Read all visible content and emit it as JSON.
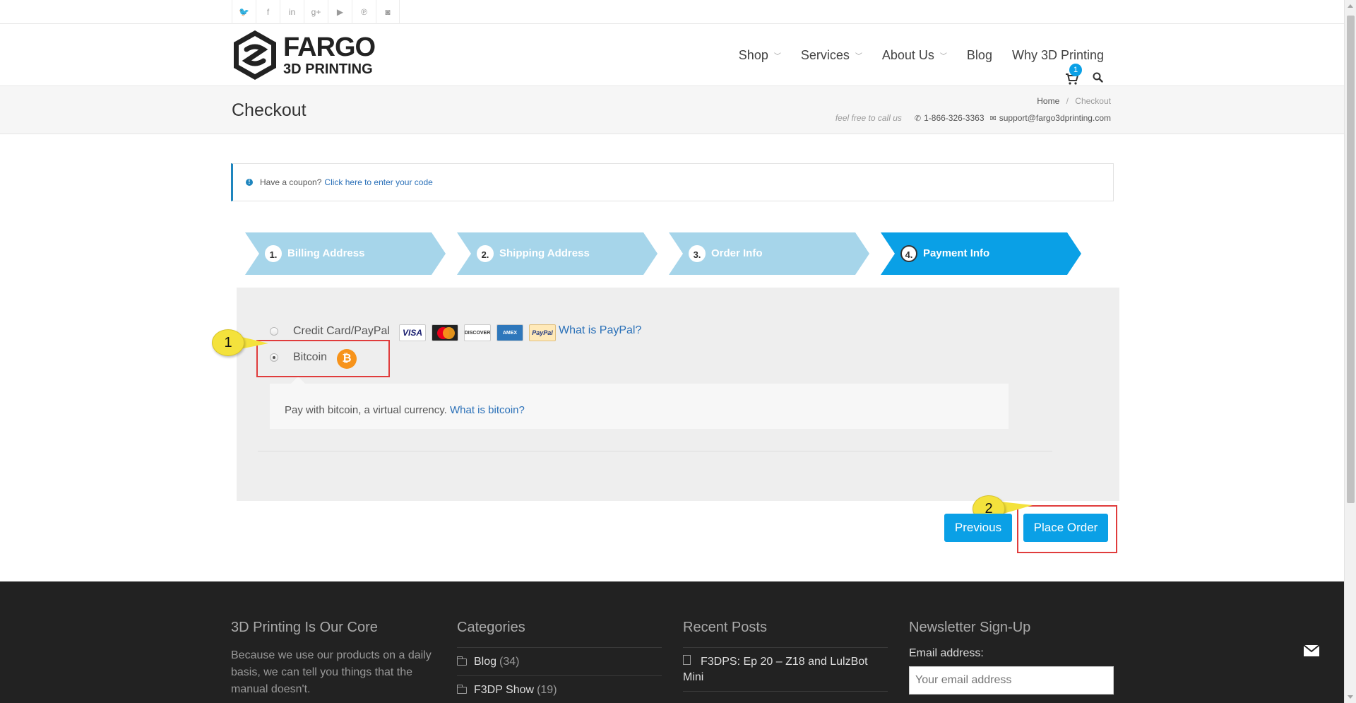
{
  "social": {
    "icons": [
      {
        "name": "twitter-icon",
        "glyph": "🐦"
      },
      {
        "name": "facebook-icon",
        "glyph": "f"
      },
      {
        "name": "linkedin-icon",
        "glyph": "in"
      },
      {
        "name": "googleplus-icon",
        "glyph": "g+"
      },
      {
        "name": "youtube-icon",
        "glyph": "▶"
      },
      {
        "name": "pinterest-icon",
        "glyph": "℗"
      },
      {
        "name": "instagram-icon",
        "glyph": "◙"
      }
    ]
  },
  "header": {
    "logo_line1": "FARGO",
    "logo_line2": "3D PRINTING",
    "nav": {
      "shop": "Shop",
      "services": "Services",
      "about": "About Us",
      "blog": "Blog",
      "why": "Why 3D Printing"
    },
    "cart_count": "1"
  },
  "title_bar": {
    "title": "Checkout",
    "breadcrumb_home": "Home",
    "breadcrumb_sep": "/",
    "breadcrumb_current": "Checkout",
    "contact_hint": "feel free to call us",
    "phone": "1-866-326-3363",
    "email": "support@fargo3dprinting.com"
  },
  "coupon": {
    "text": "Have a coupon?",
    "link": "Click here to enter your code"
  },
  "steps": [
    {
      "num": "1.",
      "label": "Billing Address"
    },
    {
      "num": "2.",
      "label": "Shipping Address"
    },
    {
      "num": "3.",
      "label": "Order Info"
    },
    {
      "num": "4.",
      "label": "Payment Info"
    }
  ],
  "colors": {
    "step_inactive": "#a6d5ea",
    "step_active": "#0aa0e6",
    "accent": "#0aa0e6",
    "highlight": "#e03c3c",
    "callout": "#f4e23c"
  },
  "payment": {
    "option_cc": "Credit Card/PayPal",
    "cards": {
      "visa": "VISA",
      "discover": "DISCOVER",
      "amex": "AMEX",
      "paypal": "PayPal"
    },
    "what_paypal": "What is PayPal?",
    "option_btc": "Bitcoin",
    "btc_symbol": "₿",
    "btc_desc": "Pay with bitcoin, a virtual currency.",
    "btc_link": "What is bitcoin?"
  },
  "callouts": {
    "one": "1",
    "two": "2"
  },
  "buttons": {
    "previous": "Previous",
    "place_order": "Place Order"
  },
  "footer": {
    "col1_title": "3D Printing Is Our Core",
    "col1_text": "Because we use our products on a daily basis, we can tell you things that the manual doesn't.",
    "col2_title": "Categories",
    "categories": [
      {
        "name": "Blog",
        "count": "(34)"
      },
      {
        "name": "F3DP Show",
        "count": "(19)"
      }
    ],
    "col3_title": "Recent Posts",
    "recent_post": "F3DPS: Ep 20 – Z18 and LulzBot Mini",
    "col4_title": "Newsletter Sign-Up",
    "email_label": "Email address:",
    "email_placeholder": "Your email address"
  }
}
